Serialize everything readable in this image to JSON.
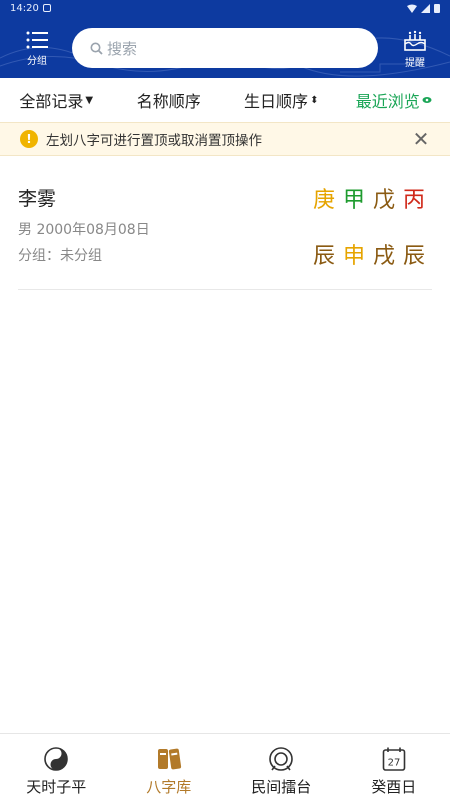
{
  "status": {
    "time": "14:20"
  },
  "header": {
    "group_label": "分组",
    "search_placeholder": "搜索",
    "remind_label": "提醒"
  },
  "filters": [
    {
      "label": "全部记录",
      "marker": "▼"
    },
    {
      "label": "名称顺序",
      "marker": ""
    },
    {
      "label": "生日顺序",
      "marker": "⬍"
    },
    {
      "label": "最近浏览",
      "marker": "👁"
    }
  ],
  "tip": {
    "text": "左划八字可进行置顶或取消置顶操作"
  },
  "records": [
    {
      "name": "李雾",
      "info": "男 2000年08月08日",
      "group": "分组：未分组",
      "stems": [
        {
          "char": "庚",
          "color": "#e6a400"
        },
        {
          "char": "甲",
          "color": "#1e9b2e"
        },
        {
          "char": "戊",
          "color": "#8a5a12"
        },
        {
          "char": "丙",
          "color": "#d0291a"
        }
      ],
      "branches": [
        {
          "char": "辰",
          "color": "#8a5a12"
        },
        {
          "char": "申",
          "color": "#e6a400"
        },
        {
          "char": "戌",
          "color": "#8a5a12"
        },
        {
          "char": "辰",
          "color": "#8a5a12"
        }
      ]
    }
  ],
  "tabs": [
    {
      "label": "天时子平",
      "icon": "yin-yang-icon"
    },
    {
      "label": "八字库",
      "icon": "books-icon"
    },
    {
      "label": "民间擂台",
      "icon": "arena-icon"
    },
    {
      "label": "癸酉日",
      "icon": "calendar-icon",
      "day": "27"
    }
  ],
  "colors": {
    "header": "#0d3aa0",
    "active_filter": "#1aa556",
    "active_tab": "#b27a2a"
  }
}
